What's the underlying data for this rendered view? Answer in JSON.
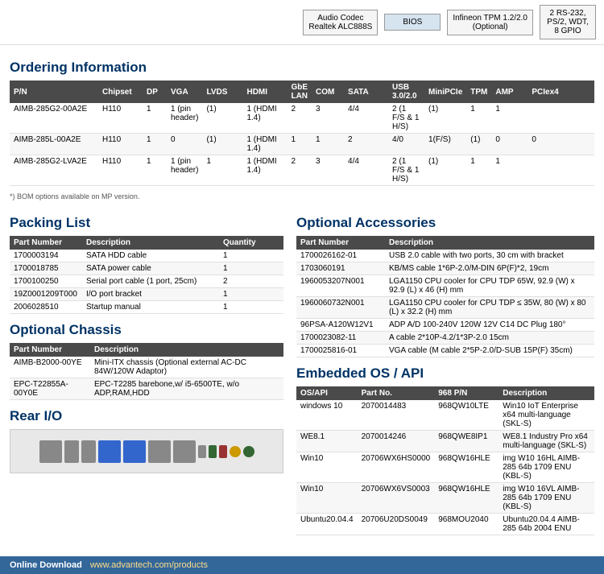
{
  "top_diagram": {
    "boxes": [
      {
        "label": "Audio Codec\nRealtek ALC888S",
        "style": "normal"
      },
      {
        "label": "BIOS",
        "style": "blue"
      },
      {
        "label": "Infineon TPM 1.2/2.0\n(Optional)",
        "style": "normal"
      },
      {
        "label": "2 RS-232,\nPS/2, WDT,\n8 GPIO",
        "style": "normal"
      }
    ]
  },
  "ordering": {
    "heading": "Ordering Information",
    "columns": [
      "P/N",
      "Chipset",
      "DP",
      "VGA",
      "LVDS",
      "HDMI",
      "GbE LAN",
      "COM",
      "SATA",
      "USB 3.0/2.0",
      "MiniPCIe",
      "TPM",
      "AMP",
      "PCIex4"
    ],
    "rows": [
      {
        "pn": "AIMB-285G2-00A2E",
        "chipset": "H110",
        "dp": "1",
        "vga": "1 (pin header)",
        "lvds": "(1)",
        "hdmi": "1 (HDMI 1.4)",
        "gbe": "2",
        "com": "3",
        "sata": "4/4",
        "usb": "2 (1 F/S & 1 H/S)",
        "minipcie": "(1)",
        "tpm": "1",
        "amp": "1",
        "pciex4": ""
      },
      {
        "pn": "AIMB-285L-00A2E",
        "chipset": "H110",
        "dp": "1",
        "vga": "0",
        "lvds": "(1)",
        "hdmi": "1 (HDMI 1.4)",
        "gbe": "1",
        "com": "1",
        "sata": "2",
        "usb": "4/0",
        "minipcie": "1(F/S)",
        "tpm": "(1)",
        "amp": "0",
        "pciex4": "0"
      },
      {
        "pn": "AIMB-285G2-LVA2E",
        "chipset": "H110",
        "dp": "1",
        "vga": "1 (pin header)",
        "lvds": "1",
        "hdmi": "1 (HDMI 1.4)",
        "gbe": "2",
        "com": "3",
        "sata": "4/4",
        "usb": "2 (1 F/S & 1 H/S)",
        "minipcie": "(1)",
        "tpm": "1",
        "amp": "1",
        "pciex4": ""
      }
    ],
    "bom_note": "*) BOM options available on MP version."
  },
  "packing_list": {
    "heading": "Packing List",
    "columns": [
      "Part Number",
      "Description",
      "Quantity"
    ],
    "rows": [
      {
        "pn": "1700003194",
        "desc": "SATA HDD cable",
        "qty": "1"
      },
      {
        "pn": "1700018785",
        "desc": "SATA power cable",
        "qty": "1"
      },
      {
        "pn": "1700100250",
        "desc": "Serial port cable (1 port, 25cm)",
        "qty": "2"
      },
      {
        "pn": "19Z0001209T000",
        "desc": "I/O port bracket",
        "qty": "1"
      },
      {
        "pn": "2006028510",
        "desc": "Startup manual",
        "qty": "1"
      }
    ]
  },
  "optional_chassis": {
    "heading": "Optional Chassis",
    "columns": [
      "Part Number",
      "Description"
    ],
    "rows": [
      {
        "pn": "AIMB-B2000-00YE",
        "desc": "Mini-ITX chassis (Optional external AC-DC 84W/120W Adaptor)"
      },
      {
        "pn": "EPC-T22855A-00Y0E",
        "desc": "EPC-T2285 barebone,w/ i5-6500TE, w/o ADP,RAM,HDD"
      }
    ]
  },
  "rear_io": {
    "heading": "Rear I/O"
  },
  "optional_accessories": {
    "heading": "Optional Accessories",
    "columns": [
      "Part Number",
      "Description"
    ],
    "rows": [
      {
        "pn": "1700026162-01",
        "desc": "USB 2.0 cable with two ports, 30 cm with bracket"
      },
      {
        "pn": "1703060191",
        "desc": "KB/MS cable 1*6P-2.0/M-DIN 6P(F)*2, 19cm"
      },
      {
        "pn": "1960053207N001",
        "desc": "LGA1150 CPU cooler for CPU TDP 65W, 92.9 (W) x 92.9 (L) x 46 (H) mm"
      },
      {
        "pn": "1960060732N001",
        "desc": "LGA1150 CPU cooler for CPU TDP ≤ 35W, 80 (W) x 80 (L) x 32.2 (H) mm"
      },
      {
        "pn": "96PSA-A120W12V1",
        "desc": "ADP A/D 100-240V 120W 12V C14 DC Plug 180°"
      },
      {
        "pn": "1700023082-11",
        "desc": "A cable 2*10P-4.2/1*3P-2.0 15cm"
      },
      {
        "pn": "1700025816-01",
        "desc": "VGA cable (M cable 2*5P-2.0/D-SUB 15P(F) 35cm)"
      }
    ]
  },
  "embedded_os": {
    "heading": "Embedded OS / API",
    "columns": [
      "OS/API",
      "Part No.",
      "968 P/N",
      "Description"
    ],
    "rows": [
      {
        "os": "windows 10",
        "pn": "2070014483",
        "part968": "968QW10LTE",
        "desc": "Win10 IoT Enterprise x64 multi-language (SKL-S)"
      },
      {
        "os": "WE8.1",
        "pn": "2070014246",
        "part968": "968QWE8IP1",
        "desc": "WE8.1 Industry Pro x64 multi-language (SKL-S)"
      },
      {
        "os": "Win10",
        "pn": "20706WX6HS0000",
        "part968": "968QW16HLE",
        "desc": "img W10 16HL AIMB-285 64b 1709 ENU (KBL-S)"
      },
      {
        "os": "Win10",
        "pn": "20706WX6VS0003",
        "part968": "968QW16HLE",
        "desc": "img W10 16VL AIMB-285 64b 1709 ENU (KBL-S)"
      },
      {
        "os": "Ubuntu20.04.4",
        "pn": "20706U20DS0049",
        "part968": "968MOU2040",
        "desc": "Ubuntu20.04.4 AIMB-285 64b 2004 ENU"
      }
    ]
  },
  "bottom_bar": {
    "label": "Online Download",
    "url": "www.advantech.com/products"
  }
}
